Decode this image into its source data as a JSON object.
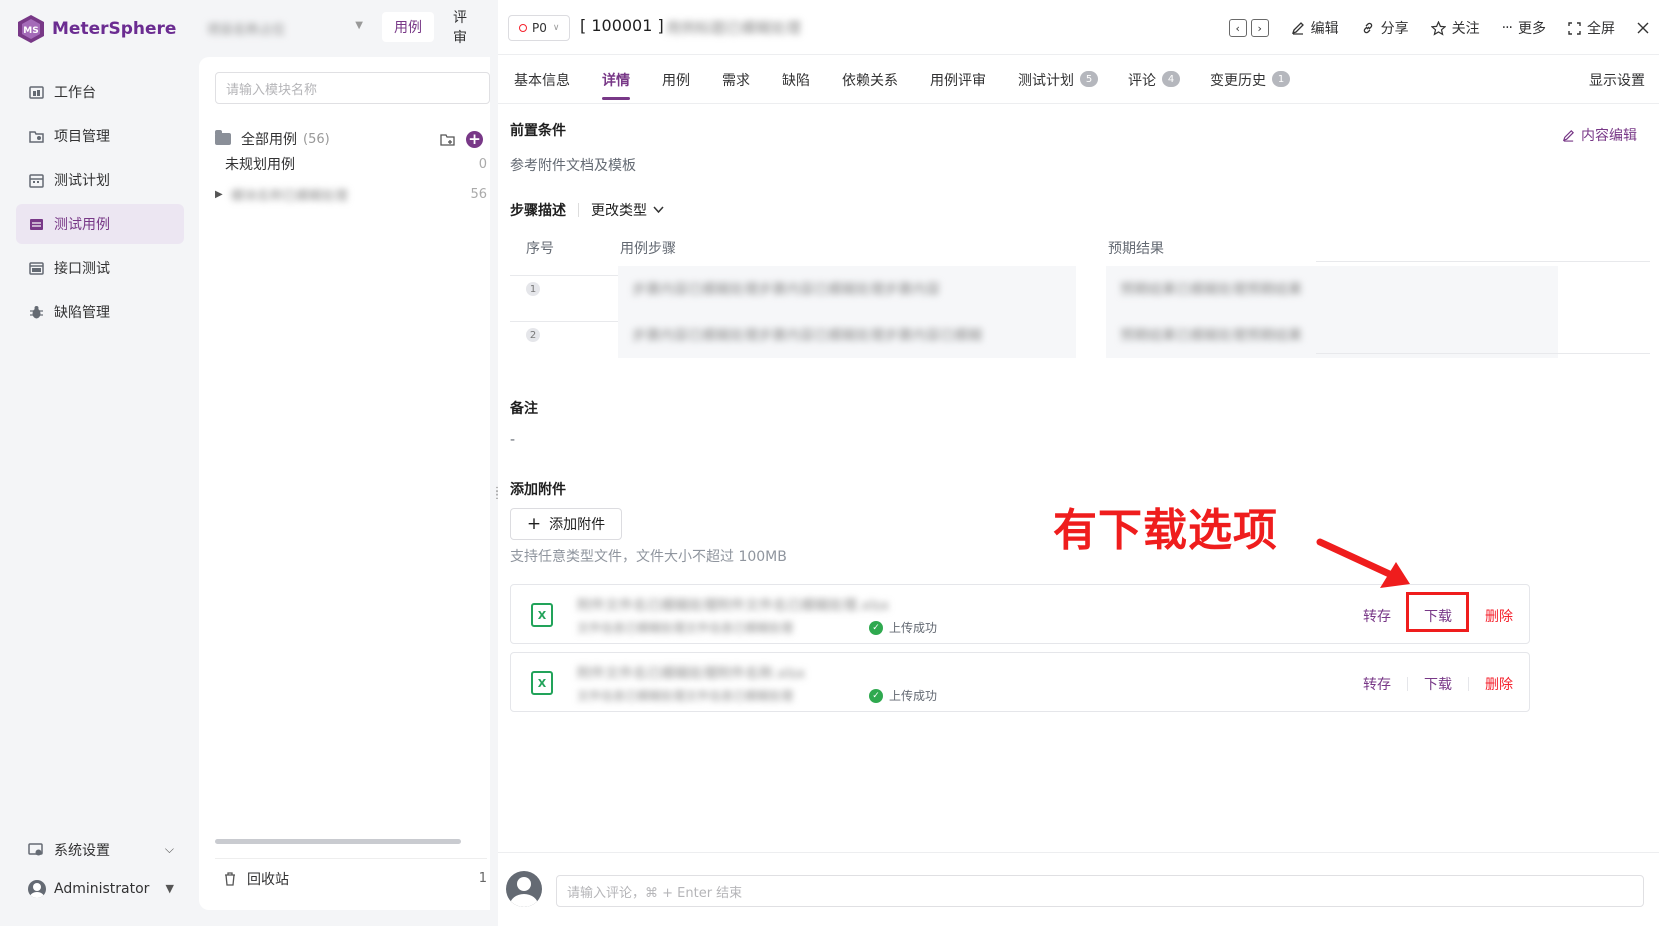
{
  "brand": {
    "name": "MeterSphere",
    "logo_text": "MS"
  },
  "nav": {
    "items": [
      {
        "label": "工作台",
        "icon": "dashboard-icon",
        "active": false
      },
      {
        "label": "项目管理",
        "icon": "folder-gear-icon",
        "active": false
      },
      {
        "label": "测试计划",
        "icon": "calendar-icon",
        "active": false
      },
      {
        "label": "测试用例",
        "icon": "case-list-icon",
        "active": true
      },
      {
        "label": "接口测试",
        "icon": "api-icon",
        "active": false
      },
      {
        "label": "缺陷管理",
        "icon": "bug-icon",
        "active": false
      }
    ],
    "system_settings": "系统设置",
    "user": "Administrator"
  },
  "tree": {
    "project_name": "项目名称占位",
    "top_tabs": [
      "用例",
      "评审"
    ],
    "search_placeholder": "请输入模块名称",
    "all_cases_label": "全部用例",
    "all_cases_count": "(56)",
    "unplanned_label": "未规划用例",
    "unplanned_count": "0",
    "module_name": "模块名称已模糊处理",
    "module_count": "56",
    "recycle_label": "回收站",
    "recycle_count": "1"
  },
  "drawer": {
    "priority": "P0",
    "case_id": "[ 100001 ]",
    "case_title": "用例标题已模糊处理",
    "actions": [
      {
        "label": "编辑",
        "icon": "edit-icon"
      },
      {
        "label": "分享",
        "icon": "link-icon"
      },
      {
        "label": "关注",
        "icon": "star-icon"
      },
      {
        "label": "更多",
        "icon": "more-icon"
      },
      {
        "label": "全屏",
        "icon": "fullscreen-icon"
      }
    ],
    "tabs": [
      {
        "label": "基本信息",
        "badge": ""
      },
      {
        "label": "详情",
        "badge": ""
      },
      {
        "label": "用例",
        "badge": ""
      },
      {
        "label": "需求",
        "badge": ""
      },
      {
        "label": "缺陷",
        "badge": ""
      },
      {
        "label": "依赖关系",
        "badge": ""
      },
      {
        "label": "用例评审",
        "badge": ""
      },
      {
        "label": "测试计划",
        "badge": "5"
      },
      {
        "label": "评论",
        "badge": "4"
      },
      {
        "label": "变更历史",
        "badge": "1"
      }
    ],
    "display_settings": "显示设置",
    "precondition_title": "前置条件",
    "precondition_text": "参考附件文档及模板",
    "content_edit": "内容编辑",
    "steps_title": "步骤描述",
    "change_type": "更改类型",
    "steps_headers": [
      "序号",
      "用例步骤",
      "预期结果"
    ],
    "steps": [
      {
        "no": "1",
        "step": "步骤内容已模糊处理步骤内容已模糊处理步骤内容",
        "expected": "预期结果已模糊处理预期结果"
      },
      {
        "no": "2",
        "step": "步骤内容已模糊处理步骤内容已模糊处理步骤内容已模糊",
        "expected": "预期结果已模糊处理预期结果"
      }
    ],
    "remark_title": "备注",
    "remark_text": "-",
    "attachment_title": "添加附件",
    "add_attachment": "添加附件",
    "attachment_hint": "支持任意类型文件，文件大小不超过 100MB",
    "files": [
      {
        "name": "附件文件名已模糊处理附件文件名已模糊处理.xlsx",
        "meta": "文件信息已模糊处理文件信息已模糊处理",
        "status": "上传成功",
        "actions": [
          "转存",
          "下载",
          "删除"
        ]
      },
      {
        "name": "附件文件名已模糊处理附件名称.xlsx",
        "meta": "文件信息已模糊处理文件信息已模糊处理",
        "status": "上传成功",
        "actions": [
          "转存",
          "下载",
          "删除"
        ]
      }
    ],
    "comment_placeholder": "请输入评论，⌘ + Enter 结束"
  },
  "annotation": {
    "text": "有下载选项",
    "color": "#ef1d1d"
  },
  "colors": {
    "accent": "#783887",
    "danger": "#f5222d",
    "success": "#2fa94f"
  }
}
